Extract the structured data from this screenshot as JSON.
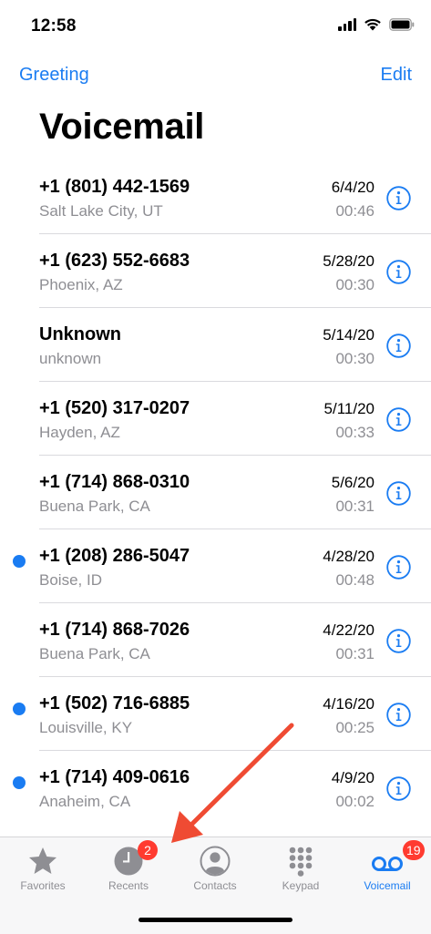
{
  "status_bar": {
    "time": "12:58",
    "icons": [
      "signal-icon",
      "wifi-icon",
      "battery-icon"
    ]
  },
  "nav": {
    "left_label": "Greeting",
    "right_label": "Edit"
  },
  "title": "Voicemail",
  "voicemails": [
    {
      "caller": "+1 (801) 442-1569",
      "location": "Salt Lake City, UT",
      "date": "6/4/20",
      "duration": "00:46",
      "unread": false
    },
    {
      "caller": "+1 (623) 552-6683",
      "location": "Phoenix, AZ",
      "date": "5/28/20",
      "duration": "00:30",
      "unread": false
    },
    {
      "caller": "Unknown",
      "location": "unknown",
      "date": "5/14/20",
      "duration": "00:30",
      "unread": false
    },
    {
      "caller": "+1 (520) 317-0207",
      "location": "Hayden, AZ",
      "date": "5/11/20",
      "duration": "00:33",
      "unread": false
    },
    {
      "caller": "+1 (714) 868-0310",
      "location": "Buena Park, CA",
      "date": "5/6/20",
      "duration": "00:31",
      "unread": false
    },
    {
      "caller": "+1 (208) 286-5047",
      "location": "Boise, ID",
      "date": "4/28/20",
      "duration": "00:48",
      "unread": true
    },
    {
      "caller": "+1 (714) 868-7026",
      "location": "Buena Park, CA",
      "date": "4/22/20",
      "duration": "00:31",
      "unread": false
    },
    {
      "caller": "+1 (502) 716-6885",
      "location": "Louisville, KY",
      "date": "4/16/20",
      "duration": "00:25",
      "unread": true
    },
    {
      "caller": "+1 (714) 409-0616",
      "location": "Anaheim, CA",
      "date": "4/9/20",
      "duration": "00:02",
      "unread": true
    }
  ],
  "tabs": [
    {
      "label": "Favorites",
      "icon": "star-icon",
      "active": false,
      "badge": null
    },
    {
      "label": "Recents",
      "icon": "clock-icon",
      "active": false,
      "badge": "2"
    },
    {
      "label": "Contacts",
      "icon": "person-icon",
      "active": false,
      "badge": null
    },
    {
      "label": "Keypad",
      "icon": "keypad-icon",
      "active": false,
      "badge": null
    },
    {
      "label": "Voicemail",
      "icon": "voicemail-icon",
      "active": true,
      "badge": "19"
    }
  ],
  "colors": {
    "accent": "#1a7cf2",
    "secondary_text": "#8e8e93",
    "badge": "#ff3b30",
    "annotation_arrow": "#ef4b33",
    "tab_bar_bg": "#f7f7f8"
  }
}
